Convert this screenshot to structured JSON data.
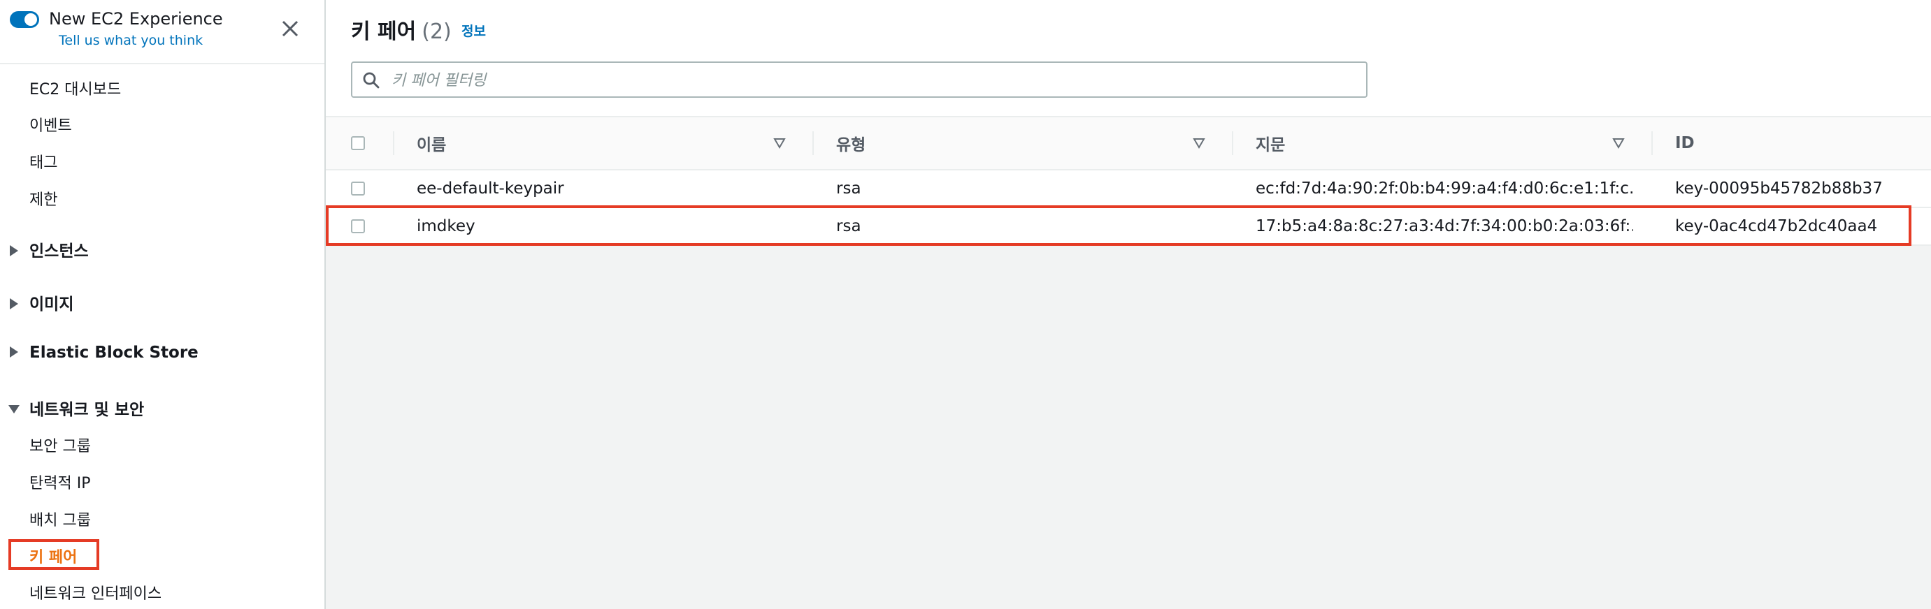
{
  "sidebar": {
    "experience_title": "New EC2 Experience",
    "feedback_link": "Tell us what you think",
    "links_top": [
      {
        "label": "EC2 대시보드"
      },
      {
        "label": "이벤트"
      },
      {
        "label": "태그"
      },
      {
        "label": "제한"
      }
    ],
    "sections": [
      {
        "label": "인스턴스",
        "expanded": false
      },
      {
        "label": "이미지",
        "expanded": false
      },
      {
        "label": "Elastic Block Store",
        "expanded": false
      },
      {
        "label": "네트워크 및 보안",
        "expanded": true
      }
    ],
    "network_links": [
      {
        "label": "보안 그룹"
      },
      {
        "label": "탄력적 IP"
      },
      {
        "label": "배치 그룹"
      },
      {
        "label": "키 페어",
        "active": true
      },
      {
        "label": "네트워크 인터페이스"
      }
    ]
  },
  "main": {
    "title": "키 페어",
    "count": "(2)",
    "info_link": "정보",
    "search": {
      "placeholder": "키 페어 필터링",
      "value": ""
    },
    "table": {
      "columns": [
        "이름",
        "유형",
        "지문",
        "ID"
      ],
      "rows": [
        {
          "name": "ee-default-keypair",
          "type": "rsa",
          "fingerprint": "ec:fd:7d:4a:90:2f:0b:b4:99:a4:f4:d0:6c:e1:1f:c…",
          "id": "key-00095b45782b88b37"
        },
        {
          "name": "imdkey",
          "type": "rsa",
          "fingerprint": "17:b5:a4:8a:8c:27:a3:4d:7f:34:00:b0:2a:03:6f:…",
          "id": "key-0ac4cd47b2dc40aa4",
          "highlighted": true
        }
      ]
    }
  },
  "colors": {
    "accent": "#0073bb",
    "active_nav": "#ec7211",
    "highlight_border": "#e53b25"
  },
  "icons": [
    "toggle-switch",
    "close-icon",
    "caret-right-icon",
    "caret-down-icon",
    "search-icon",
    "sort-icon"
  ]
}
